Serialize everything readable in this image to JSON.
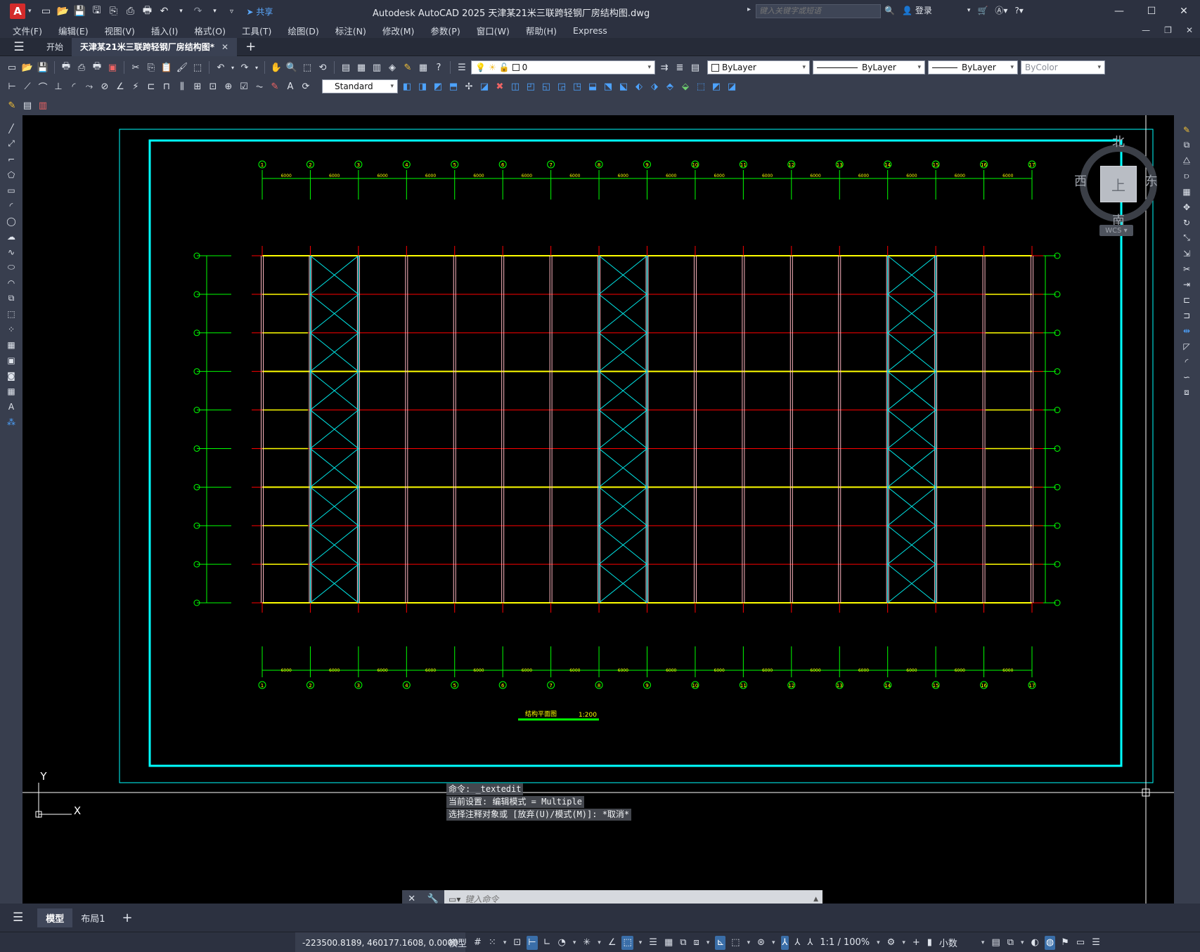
{
  "titlebar": {
    "app_letter": "A",
    "share_label": "共享",
    "title": "Autodesk AutoCAD 2025    天津某21米三联跨轻钢厂房结构图.dwg",
    "search_placeholder": "键入关键字或短语",
    "login_label": "登录"
  },
  "menubar": {
    "items": [
      "文件(F)",
      "编辑(E)",
      "视图(V)",
      "插入(I)",
      "格式(O)",
      "工具(T)",
      "绘图(D)",
      "标注(N)",
      "修改(M)",
      "参数(P)",
      "窗口(W)",
      "帮助(H)",
      "Express"
    ]
  },
  "doctabs": {
    "start": "开始",
    "active": "天津某21米三联跨轻钢厂房结构图*"
  },
  "toolbar": {
    "layer_current": "0",
    "color": "ByLayer",
    "linetype": "ByLayer",
    "lineweight": "ByLayer",
    "plotstyle": "ByColor",
    "textstyle": "Standard"
  },
  "viewcube": {
    "north": "北",
    "south": "南",
    "east": "东",
    "west": "西",
    "top": "上",
    "wcs": "WCS"
  },
  "drawing": {
    "grid_numbers": [
      "1",
      "2",
      "3",
      "4",
      "5",
      "6",
      "7",
      "8",
      "9",
      "10",
      "11",
      "12",
      "13",
      "14",
      "15",
      "16",
      "17"
    ],
    "grid_letters": [
      "K",
      "J",
      "H",
      "G",
      "F",
      "E",
      "D",
      "C",
      "B",
      "A"
    ],
    "bay_dims_top": [
      "6000",
      "6000",
      "6000",
      "6000",
      "6000",
      "6000",
      "6000",
      "6000",
      "6000",
      "6000",
      "6000",
      "6000",
      "6000",
      "6000",
      "6000",
      "6000"
    ],
    "title": "结构平面图",
    "scale": "1:200",
    "ucs_x": "X",
    "ucs_y": "Y"
  },
  "command": {
    "history": [
      "命令: _textedit",
      "当前设置: 编辑模式 = Multiple",
      "选择注释对象或 [放弃(U)/模式(M)]: *取消*"
    ],
    "placeholder": "键入命令"
  },
  "layouttabs": {
    "model": "模型",
    "layout1": "布局1"
  },
  "statusbar": {
    "coords": "-223500.8189, 460177.1608, 0.0000",
    "model": "模型",
    "annoscale": "1:1 / 100%",
    "units": "小数"
  },
  "colors": {
    "background": "#000000",
    "frame": "#00ffff",
    "grid_line": "#00ff00",
    "beam": "#ffff00",
    "purlin": "#ff0000",
    "column": "#ffb6c1",
    "bracing": "#00e5e5"
  }
}
